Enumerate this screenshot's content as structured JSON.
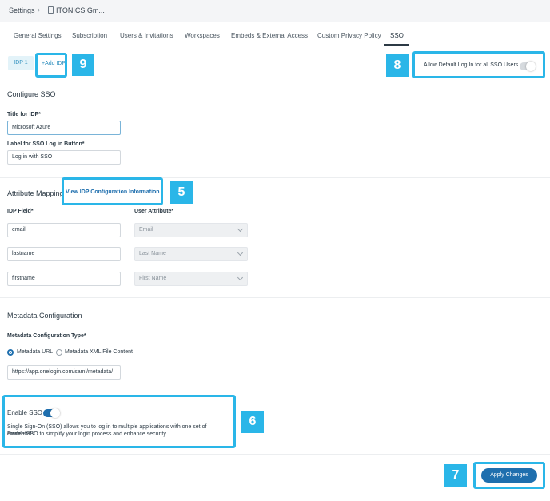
{
  "breadcrumb": {
    "root": "Settings",
    "separator": "›",
    "org": "ITONICS Gm..."
  },
  "tabs": [
    "General Settings",
    "Subscription",
    "Users & Invitations",
    "Workspaces",
    "Embeds & External Access",
    "Custom Privacy Policy",
    "SSO"
  ],
  "idp": {
    "chip": "IDP 1",
    "add_label": "+Add IDP"
  },
  "allow_default": {
    "label": "Allow Default Log In for all SSO Users",
    "enabled": false
  },
  "configure": {
    "title": "Configure SSO",
    "title_label": "Title for IDP*",
    "title_value": "Microsoft Azure",
    "button_label": "Label for SSO Log in Button*",
    "button_value": "Log in with SSO"
  },
  "attribute": {
    "title": "Attribute Mapping",
    "config_link": "View IDP Configuration Information",
    "idp_field_header": "IDP Field*",
    "user_attr_header": "User Attribute*",
    "rows": [
      {
        "field": "email",
        "attribute": "Email"
      },
      {
        "field": "lastname",
        "attribute": "Last Name"
      },
      {
        "field": "firstname",
        "attribute": "First Name"
      }
    ]
  },
  "metadata": {
    "title": "Metadata Configuration",
    "type_label": "Metadata Configuration Type*",
    "option_url": "Metadata URL",
    "option_xml": "Metadata XML File Content",
    "selected": "url",
    "url_value": "https://app.onelogin.com/saml/metadata/"
  },
  "enable_sso": {
    "label": "Enable SSO",
    "enabled": true,
    "description_1": "Single Sign-On (SSO) allows you to log in to multiple applications with one set of credentials.",
    "description_2": "Enable SSO to simplify your login process and enhance security."
  },
  "apply_label": "Apply Changes",
  "badges": {
    "n5": "5",
    "n6": "6",
    "n7": "7",
    "n8": "8",
    "n9": "9"
  },
  "colors": {
    "highlight": "#2ab6e8",
    "primary": "#1f6fae",
    "link": "#2a8dbd"
  },
  "icons": {
    "breadcrumb_org": "document-icon",
    "dropdown": "chevron-down-icon"
  }
}
